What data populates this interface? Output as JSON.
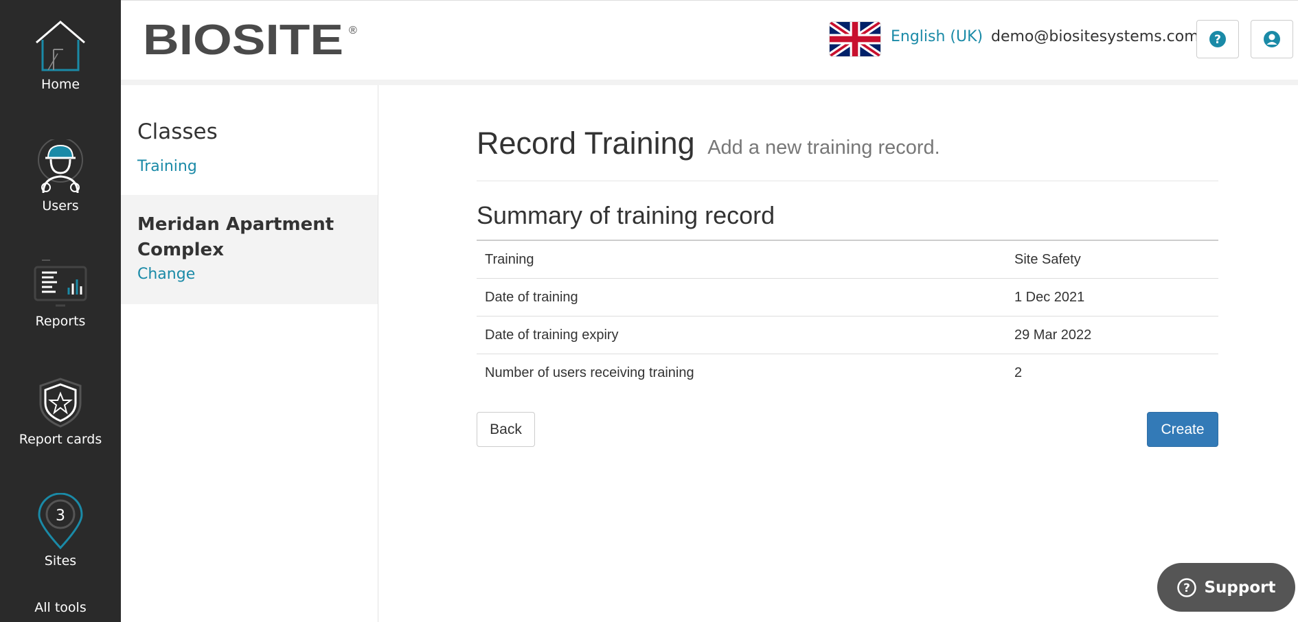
{
  "nav": {
    "items": [
      {
        "label": "Home",
        "icon": "home-icon"
      },
      {
        "label": "Users",
        "icon": "worker-icon"
      },
      {
        "label": "Reports",
        "icon": "reports-icon"
      },
      {
        "label": "Report cards",
        "icon": "shield-star-icon"
      },
      {
        "label": "Sites",
        "icon": "map-pin-icon"
      },
      {
        "label": "All tools",
        "icon": "grid-icon"
      }
    ]
  },
  "header": {
    "logo_text": "BIOSITE",
    "logo_mark": "®",
    "language": "English (UK)",
    "email": "demo@biositesystems.com",
    "help_icon": "question-icon",
    "account_icon": "user-icon"
  },
  "sidebar": {
    "classes_title": "Classes",
    "classes_link": "Training",
    "site_name": "Meridan Apartment Complex",
    "site_change": "Change"
  },
  "main": {
    "title": "Record Training",
    "subtitle": "Add a new training record.",
    "summary_title": "Summary of training record",
    "rows": [
      {
        "label": "Training",
        "value": "Site Safety"
      },
      {
        "label": "Date of training",
        "value": "1 Dec 2021"
      },
      {
        "label": "Date of training expiry",
        "value": "29 Mar 2022"
      },
      {
        "label": "Number of users receiving training",
        "value": "2"
      }
    ],
    "back_label": "Back",
    "create_label": "Create"
  },
  "support": {
    "label": "Support"
  },
  "colors": {
    "nav_bg": "#2a2a2a",
    "accent": "#1a8aa7",
    "primary": "#337ab7"
  }
}
